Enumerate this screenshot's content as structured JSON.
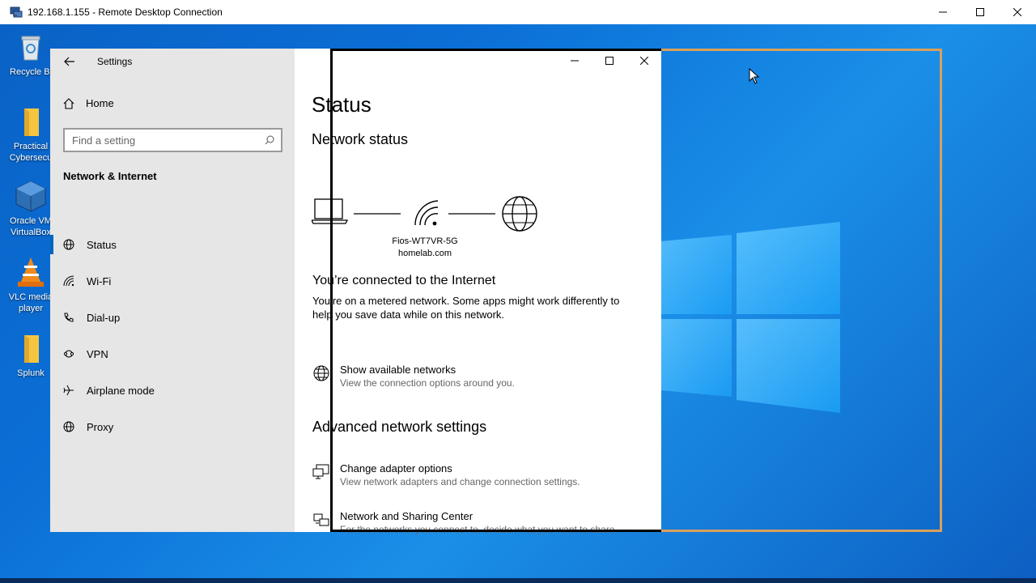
{
  "rdp": {
    "title": "192.168.1.155 - Remote Desktop Connection"
  },
  "desktop_icons": [
    {
      "label": "Recycle Bi",
      "icon": "recycle-bin-icon"
    },
    {
      "label": "Practical\nCybersecu",
      "icon": "folder-icon"
    },
    {
      "label": "Oracle VM\nVirtualBox",
      "icon": "virtualbox-icon"
    },
    {
      "label": "VLC media\nplayer",
      "icon": "vlc-icon"
    },
    {
      "label": "Splunk",
      "icon": "folder-icon"
    }
  ],
  "settings": {
    "app_title": "Settings",
    "home_label": "Home",
    "search_placeholder": "Find a setting",
    "section_header": "Network & Internet",
    "nav": [
      {
        "label": "Status",
        "icon": "globe-icon",
        "active": true
      },
      {
        "label": "Wi-Fi",
        "icon": "wifi-icon",
        "active": false
      },
      {
        "label": "Dial-up",
        "icon": "phone-icon",
        "active": false
      },
      {
        "label": "VPN",
        "icon": "vpn-icon",
        "active": false
      },
      {
        "label": "Airplane mode",
        "icon": "airplane-icon",
        "active": false
      },
      {
        "label": "Proxy",
        "icon": "globe-icon",
        "active": false
      }
    ],
    "content": {
      "page_title": "Status",
      "network_status_header": "Network status",
      "network_name": "Fios-WT7VR-5G",
      "domain": "homelab.com",
      "connected_header": "You’re connected to the Internet",
      "connected_desc": "You’re on a metered network. Some apps might work differently to help you save data while on this network.",
      "links": [
        {
          "title": "Show available networks",
          "sub": "View the connection options around you.",
          "icon": "globe-icon"
        }
      ],
      "advanced_header": "Advanced network settings",
      "advanced_links": [
        {
          "title": "Change adapter options",
          "sub": "View network adapters and change connection settings.",
          "icon": "adapter-icon"
        },
        {
          "title": "Network and Sharing Center",
          "sub": "For the networks you connect to, decide what you want to share.",
          "icon": "sharing-icon"
        }
      ]
    }
  },
  "colors": {
    "accent": "#0067c0",
    "sidebar_bg": "#e6e6e6",
    "frame_orange": "#d9a05a"
  }
}
